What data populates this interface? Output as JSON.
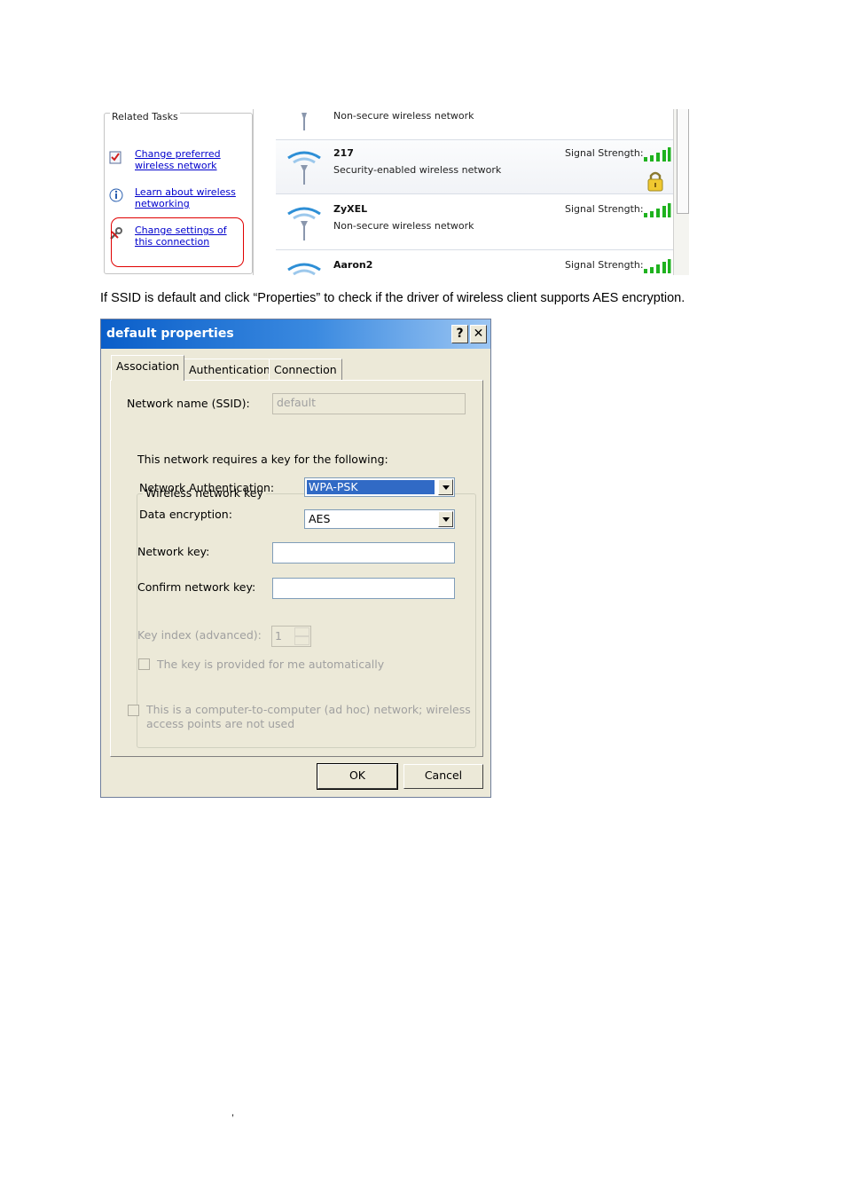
{
  "related_tasks": {
    "title": "Related Tasks",
    "items": [
      {
        "label": "Change preferred wireless network",
        "icon": "checklist-icon"
      },
      {
        "label": "Learn about wireless networking",
        "icon": "info-icon"
      },
      {
        "label": "Change settings of this connection",
        "icon": "wrench-icon"
      }
    ]
  },
  "networks": [
    {
      "name": "",
      "description": "Non-secure wireless network",
      "signal_label": ""
    },
    {
      "name": "217",
      "description": "Security-enabled wireless network",
      "signal_label": "Signal Strength:",
      "secured": true
    },
    {
      "name": "ZyXEL",
      "description": "Non-secure wireless network",
      "signal_label": "Signal Strength:"
    },
    {
      "name": "Aaron2",
      "description": "",
      "signal_label": "Signal Strength:"
    }
  ],
  "caption": "If SSID is default and click “Properties” to check if the driver of wireless client supports AES encryption.",
  "stray_mark": ",",
  "dialog": {
    "title": "default properties",
    "help_label": "?",
    "close_label": "✕",
    "tabs": [
      "Association",
      "Authentication",
      "Connection"
    ],
    "ssid_label": "Network name (SSID):",
    "ssid_value": "default",
    "key_group_title": "Wireless network key",
    "requires_text": "This network requires a key for the following:",
    "auth_label": "Network Authentication:",
    "auth_value": "WPA-PSK",
    "encryption_label": "Data encryption:",
    "encryption_value": "AES",
    "network_key_label": "Network key:",
    "confirm_key_label": "Confirm network key:",
    "key_index_label": "Key index (advanced):",
    "key_index_value": "1",
    "auto_key_label": "The key is provided for me automatically",
    "adhoc_label_line1": "This is a computer-to-computer (ad hoc) network; wireless",
    "adhoc_label_line2": "access points are not used",
    "ok_label": "OK",
    "cancel_label": "Cancel"
  },
  "colors": {
    "title_bar": "#0a5ec9",
    "dialog_bg": "#ece9d8",
    "link": "#0000cc",
    "highlight_ring": "#e00000",
    "selection": "#316ac5",
    "signal_green": "#1fb21f"
  }
}
